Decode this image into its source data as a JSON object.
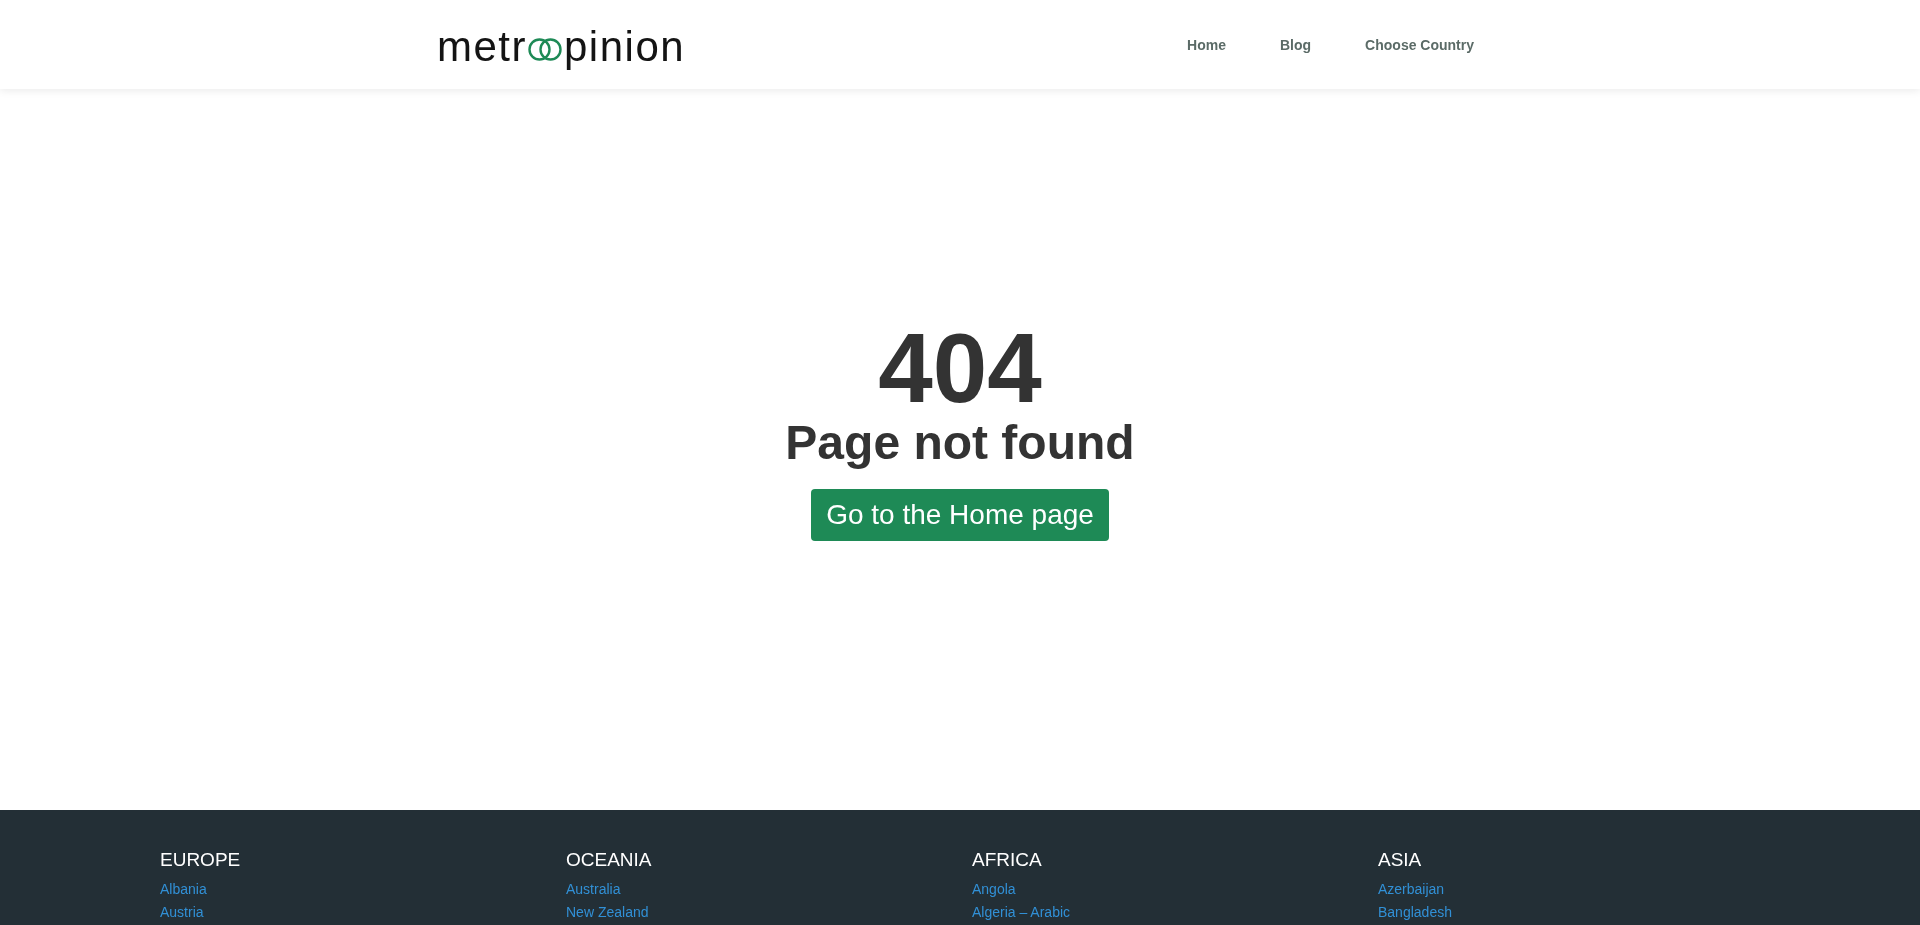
{
  "header": {
    "logo": {
      "text_before": "metr",
      "text_after": "pinion"
    },
    "nav": [
      {
        "label": "Home"
      },
      {
        "label": "Blog"
      },
      {
        "label": "Choose Country"
      }
    ]
  },
  "error": {
    "code": "404",
    "message": "Page not found",
    "button": "Go to the Home page"
  },
  "footer": {
    "regions": [
      {
        "title": "EUROPE",
        "countries": [
          "Albania",
          "Austria"
        ]
      },
      {
        "title": "OCEANIA",
        "countries": [
          "Australia",
          "New Zealand"
        ]
      },
      {
        "title": "AFRICA",
        "countries": [
          "Angola",
          "Algeria – Arabic"
        ]
      },
      {
        "title": "ASIA",
        "countries": [
          "Azerbaijan",
          "Bangladesh"
        ]
      }
    ]
  }
}
